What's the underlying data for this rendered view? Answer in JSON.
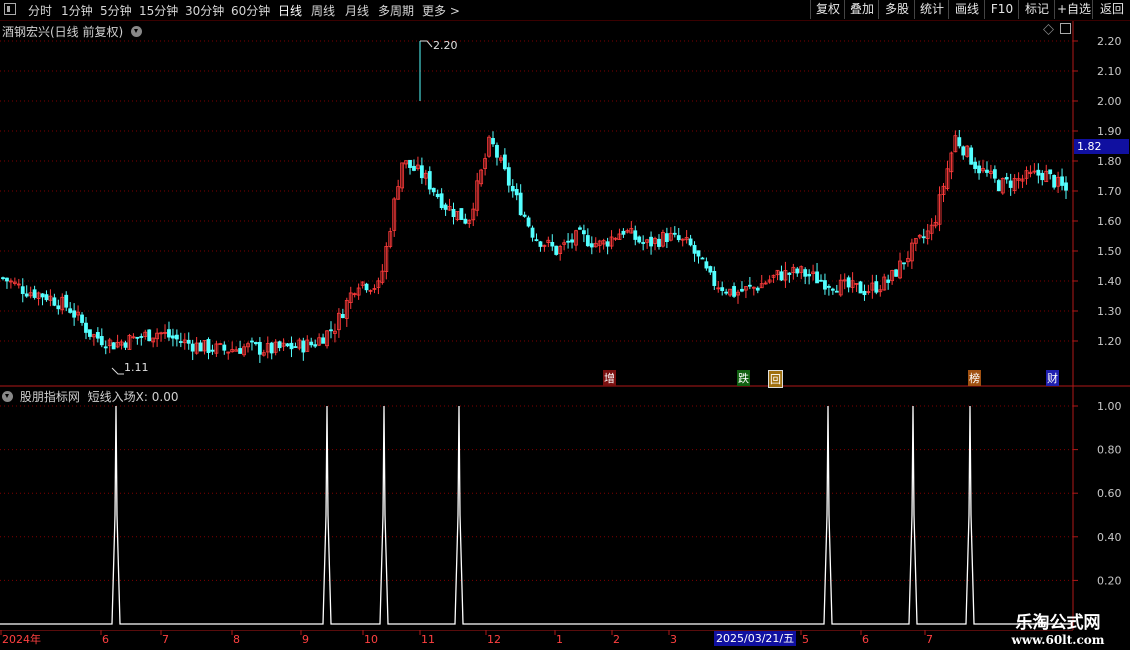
{
  "toolbar": {
    "periods": [
      "分时",
      "1分钟",
      "5分钟",
      "15分钟",
      "30分钟",
      "60分钟",
      "日线",
      "周线",
      "月线",
      "多周期",
      "更多 >"
    ],
    "active_period": "日线",
    "right_buttons": [
      "复权",
      "叠加",
      "多股",
      "统计",
      "画线",
      "F10",
      "标记",
      "+自选",
      "返回"
    ]
  },
  "main": {
    "title": "酒钢宏兴(日线 前复权)",
    "y_ticks": [
      "2.20",
      "2.10",
      "2.00",
      "1.90",
      "1.80",
      "1.70",
      "1.60",
      "1.50",
      "1.40",
      "1.30",
      "1.20"
    ],
    "price_tag": "1.82",
    "high_label": "2.20",
    "low_label": "1.11",
    "event_markers": [
      "增",
      "跌",
      "回",
      "榜",
      "财"
    ]
  },
  "indicator": {
    "title": "股朋指标网",
    "formula_label": "短线入场X:",
    "formula_value": "0.00",
    "y_ticks": [
      "1.00",
      "0.80",
      "0.60",
      "0.40",
      "0.20"
    ]
  },
  "x_axis": {
    "labels": [
      "2024年",
      "6",
      "7",
      "8",
      "9",
      "10",
      "11",
      "12",
      "1",
      "2",
      "3",
      "5",
      "6",
      "7"
    ],
    "highlight_date": "2025/03/21/五"
  },
  "watermark": {
    "line1": "乐淘公式网",
    "line2": "www.60lt.com"
  },
  "colors": {
    "up": "#ff3b3b",
    "down": "#54ffff",
    "grid": "#800000",
    "axis": "#b01818",
    "price_tag_bg": "#1010a0"
  },
  "chart_data": [
    {
      "type": "candlestick",
      "title": "酒钢宏兴(日线 前复权)",
      "x_range": [
        "2024年",
        "7"
      ],
      "ylim": [
        1.11,
        2.2
      ],
      "grid": true,
      "approx_close_path": [
        1.41,
        1.37,
        1.35,
        1.31,
        1.22,
        1.19,
        1.21,
        1.23,
        1.2,
        1.18,
        1.17,
        1.18,
        1.17,
        1.18,
        1.19,
        1.25,
        1.4,
        1.38,
        1.8,
        1.75,
        1.65,
        1.6,
        1.87,
        1.7,
        1.55,
        1.5,
        1.55,
        1.52,
        1.57,
        1.52,
        1.55,
        1.52,
        1.4,
        1.36,
        1.38,
        1.42,
        1.43,
        1.4,
        1.38,
        1.37,
        1.4,
        1.5,
        1.58,
        1.88,
        1.78,
        1.72,
        1.74,
        1.76,
        1.7
      ],
      "high": 2.2,
      "low": 1.11,
      "last": 1.82
    },
    {
      "type": "line",
      "title": "股朋指标网",
      "series": [
        {
          "name": "短线入场X",
          "spikes_at": [
            "6",
            "9",
            "10",
            "11",
            "5",
            "6",
            "7"
          ],
          "value": 1.0
        }
      ],
      "ylim": [
        0,
        1.0
      ],
      "current": 0.0
    }
  ]
}
